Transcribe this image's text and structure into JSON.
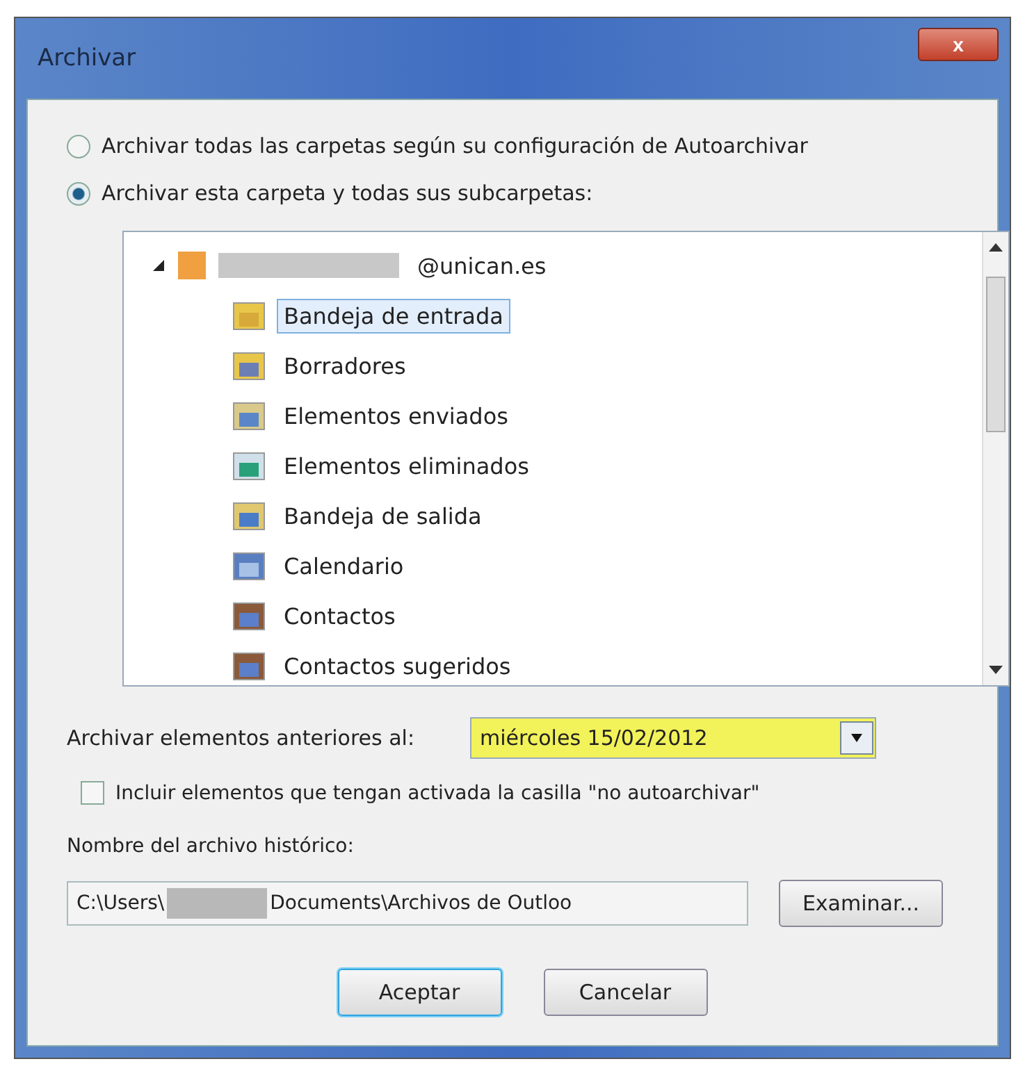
{
  "window": {
    "title": "Archivar",
    "close": "x"
  },
  "options": [
    {
      "label": "Archivar todas las carpetas según su configuración de Autoarchivar",
      "selected": false
    },
    {
      "label": "Archivar esta carpeta y todas sus subcarpetas:",
      "selected": true
    }
  ],
  "tree": {
    "root": {
      "label": "@unican.es",
      "expanded": true,
      "children": [
        {
          "label": "Bandeja de entrada",
          "kind": "inbox",
          "selected": true
        },
        {
          "label": "Borradores",
          "kind": "drafts",
          "selected": false
        },
        {
          "label": "Elementos enviados",
          "kind": "sent",
          "selected": false
        },
        {
          "label": "Elementos eliminados",
          "kind": "deleted",
          "selected": false
        },
        {
          "label": "Bandeja de salida",
          "kind": "outbox",
          "selected": false
        },
        {
          "label": "Calendario",
          "kind": "calendar",
          "selected": false
        },
        {
          "label": "Contactos",
          "kind": "contacts",
          "selected": false
        },
        {
          "label": "Contactos sugeridos",
          "kind": "contacts",
          "selected": false
        }
      ]
    }
  },
  "date": {
    "label": "Archivar elementos anteriores al:",
    "value": "miércoles 15/02/2012"
  },
  "include": {
    "label": "Incluir elementos que tengan activada la casilla \"no autoarchivar\"",
    "checked": false
  },
  "file": {
    "label": "Nombre del archivo histórico:",
    "value_start": "C:\\Users\\",
    "value_end": "Documents\\Archivos de Outloo",
    "browse": "Examinar..."
  },
  "buttons": [
    {
      "label": "Aceptar",
      "default": true
    },
    {
      "label": "Cancelar",
      "default": false
    }
  ]
}
